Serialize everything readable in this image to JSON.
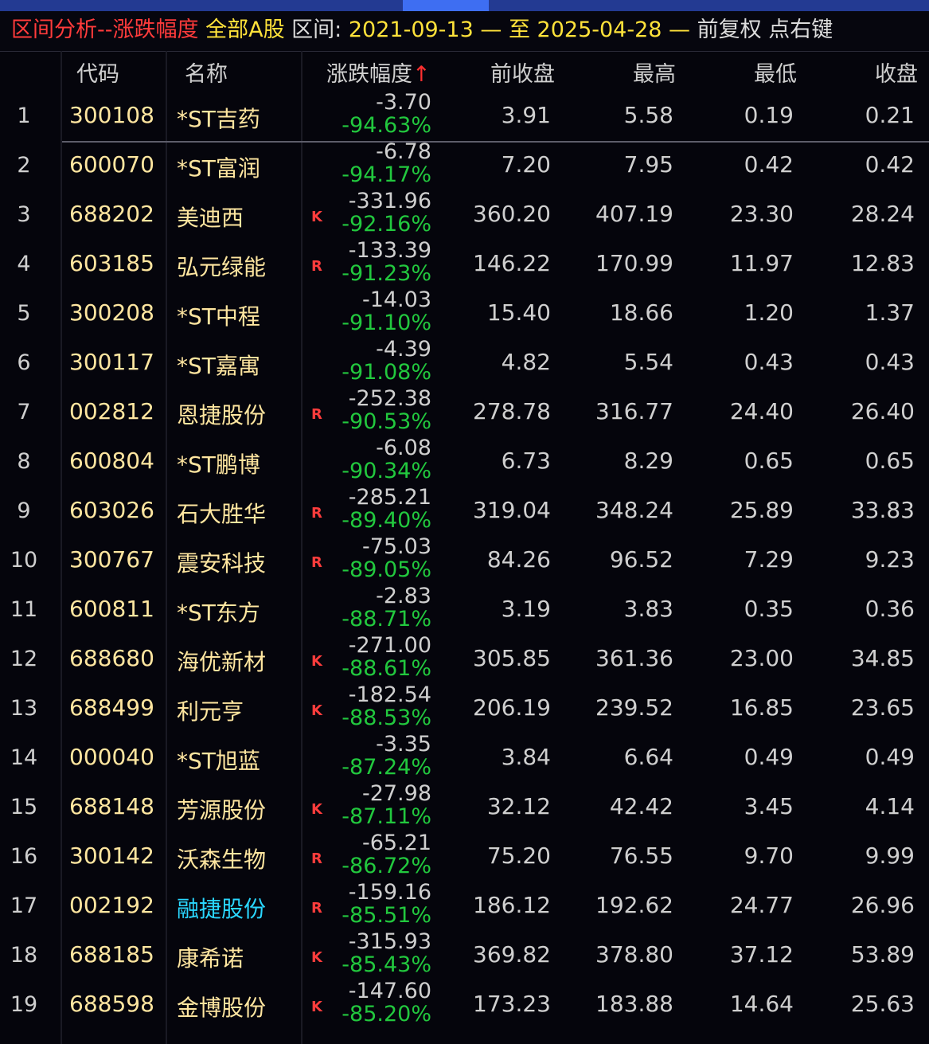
{
  "title": {
    "part1": "区间分析--涨跌幅度",
    "part2": "全部A股",
    "part3": "区间:",
    "part4": "2021-09-13 — 至 2025-04-28 —",
    "part5": "前复权 点右键",
    "colors": {
      "red": "#ff3b3b",
      "yellow": "#ffe23a",
      "white": "#dcdcdc"
    }
  },
  "header": {
    "code": "代码",
    "name": "名称",
    "change": "涨跌幅度",
    "sort_arrow": "↑",
    "prev_close": "前收盘",
    "high": "最高",
    "low": "最低",
    "close": "收盘"
  },
  "rows": [
    {
      "idx": "1",
      "code": "300108",
      "name": "*ST吉药",
      "flag": "",
      "chg": "-3.70",
      "pct": "-94.63%",
      "prev": "3.91",
      "high": "5.58",
      "low": "0.19",
      "close": "0.21"
    },
    {
      "idx": "2",
      "code": "600070",
      "name": "*ST富润",
      "flag": "",
      "chg": "-6.78",
      "pct": "-94.17%",
      "prev": "7.20",
      "high": "7.95",
      "low": "0.42",
      "close": "0.42"
    },
    {
      "idx": "3",
      "code": "688202",
      "name": "美迪西",
      "flag": "K",
      "chg": "-331.96",
      "pct": "-92.16%",
      "prev": "360.20",
      "high": "407.19",
      "low": "23.30",
      "close": "28.24"
    },
    {
      "idx": "4",
      "code": "603185",
      "name": "弘元绿能",
      "flag": "R",
      "chg": "-133.39",
      "pct": "-91.23%",
      "prev": "146.22",
      "high": "170.99",
      "low": "11.97",
      "close": "12.83"
    },
    {
      "idx": "5",
      "code": "300208",
      "name": "*ST中程",
      "flag": "",
      "chg": "-14.03",
      "pct": "-91.10%",
      "prev": "15.40",
      "high": "18.66",
      "low": "1.20",
      "close": "1.37"
    },
    {
      "idx": "6",
      "code": "300117",
      "name": "*ST嘉寓",
      "flag": "",
      "chg": "-4.39",
      "pct": "-91.08%",
      "prev": "4.82",
      "high": "5.54",
      "low": "0.43",
      "close": "0.43"
    },
    {
      "idx": "7",
      "code": "002812",
      "name": "恩捷股份",
      "flag": "R",
      "chg": "-252.38",
      "pct": "-90.53%",
      "prev": "278.78",
      "high": "316.77",
      "low": "24.40",
      "close": "26.40"
    },
    {
      "idx": "8",
      "code": "600804",
      "name": "*ST鹏博",
      "flag": "",
      "chg": "-6.08",
      "pct": "-90.34%",
      "prev": "6.73",
      "high": "8.29",
      "low": "0.65",
      "close": "0.65"
    },
    {
      "idx": "9",
      "code": "603026",
      "name": "石大胜华",
      "flag": "R",
      "chg": "-285.21",
      "pct": "-89.40%",
      "prev": "319.04",
      "high": "348.24",
      "low": "25.89",
      "close": "33.83"
    },
    {
      "idx": "10",
      "code": "300767",
      "name": "震安科技",
      "flag": "R",
      "chg": "-75.03",
      "pct": "-89.05%",
      "prev": "84.26",
      "high": "96.52",
      "low": "7.29",
      "close": "9.23"
    },
    {
      "idx": "11",
      "code": "600811",
      "name": "*ST东方",
      "flag": "",
      "chg": "-2.83",
      "pct": "-88.71%",
      "prev": "3.19",
      "high": "3.83",
      "low": "0.35",
      "close": "0.36"
    },
    {
      "idx": "12",
      "code": "688680",
      "name": "海优新材",
      "flag": "K",
      "chg": "-271.00",
      "pct": "-88.61%",
      "prev": "305.85",
      "high": "361.36",
      "low": "23.00",
      "close": "34.85"
    },
    {
      "idx": "13",
      "code": "688499",
      "name": "利元亨",
      "flag": "K",
      "chg": "-182.54",
      "pct": "-88.53%",
      "prev": "206.19",
      "high": "239.52",
      "low": "16.85",
      "close": "23.65"
    },
    {
      "idx": "14",
      "code": "000040",
      "name": "*ST旭蓝",
      "flag": "",
      "chg": "-3.35",
      "pct": "-87.24%",
      "prev": "3.84",
      "high": "6.64",
      "low": "0.49",
      "close": "0.49"
    },
    {
      "idx": "15",
      "code": "688148",
      "name": "芳源股份",
      "flag": "K",
      "chg": "-27.98",
      "pct": "-87.11%",
      "prev": "32.12",
      "high": "42.42",
      "low": "3.45",
      "close": "4.14"
    },
    {
      "idx": "16",
      "code": "300142",
      "name": "沃森生物",
      "flag": "R",
      "chg": "-65.21",
      "pct": "-86.72%",
      "prev": "75.20",
      "high": "76.55",
      "low": "9.70",
      "close": "9.99"
    },
    {
      "idx": "17",
      "code": "002192",
      "name": "融捷股份",
      "flag": "R",
      "chg": "-159.16",
      "pct": "-85.51%",
      "prev": "186.12",
      "high": "192.62",
      "low": "24.77",
      "close": "26.96",
      "name_color": "cyan"
    },
    {
      "idx": "18",
      "code": "688185",
      "name": "康希诺",
      "flag": "K",
      "chg": "-315.93",
      "pct": "-85.43%",
      "prev": "369.82",
      "high": "378.80",
      "low": "37.12",
      "close": "53.89"
    },
    {
      "idx": "19",
      "code": "688598",
      "name": "金博股份",
      "flag": "K",
      "chg": "-147.60",
      "pct": "-85.20%",
      "prev": "173.23",
      "high": "183.88",
      "low": "14.64",
      "close": "25.63"
    }
  ]
}
